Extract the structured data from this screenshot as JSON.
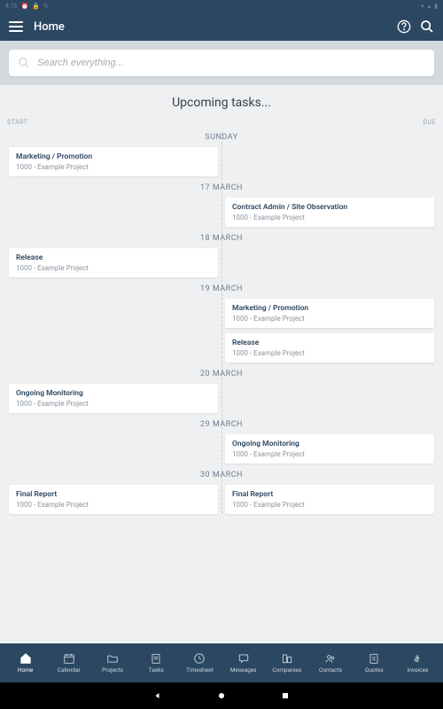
{
  "status": {
    "time": "4:16",
    "icons_left": [
      "clock",
      "lock",
      "sync"
    ],
    "icons_right": [
      "wifi",
      "signal",
      "battery"
    ]
  },
  "header": {
    "title": "Home"
  },
  "search": {
    "placeholder": "Search everything..."
  },
  "page_title": "Upcoming tasks...",
  "col_labels": {
    "start": "START",
    "due": "DUE"
  },
  "dates": [
    {
      "label": "SUNDAY",
      "left": [
        {
          "title": "Marketing / Promotion",
          "sub": "1000 - Example Project"
        }
      ],
      "right": []
    },
    {
      "label": "17 MARCH",
      "left": [],
      "right": [
        {
          "title": "Contract Admin / Site Observation",
          "sub": "1000 - Example Project"
        }
      ]
    },
    {
      "label": "18 MARCH",
      "left": [
        {
          "title": "Release",
          "sub": "1000 - Example Project"
        }
      ],
      "right": []
    },
    {
      "label": "19 MARCH",
      "left": [],
      "right": [
        {
          "title": "Marketing / Promotion",
          "sub": "1000 - Example Project"
        },
        {
          "title": "Release",
          "sub": "1000 - Example Project"
        }
      ]
    },
    {
      "label": "20 MARCH",
      "left": [
        {
          "title": "Ongoing Monitoring",
          "sub": "1000 - Example Project"
        }
      ],
      "right": []
    },
    {
      "label": "29 MARCH",
      "left": [],
      "right": [
        {
          "title": "Ongoing Monitoring",
          "sub": "1000 - Example Project"
        }
      ]
    },
    {
      "label": "30 MARCH",
      "left": [
        {
          "title": "Final Report",
          "sub": "1000 - Example Project"
        }
      ],
      "right": [
        {
          "title": "Final Report",
          "sub": "1000 - Example Project"
        }
      ]
    }
  ],
  "nav": [
    {
      "key": "home",
      "label": "Home",
      "active": true
    },
    {
      "key": "calendar",
      "label": "Calendar"
    },
    {
      "key": "projects",
      "label": "Projects"
    },
    {
      "key": "tasks",
      "label": "Tasks"
    },
    {
      "key": "timesheet",
      "label": "Timesheet"
    },
    {
      "key": "messages",
      "label": "Messages"
    },
    {
      "key": "companies",
      "label": "Companies"
    },
    {
      "key": "contacts",
      "label": "Contacts"
    },
    {
      "key": "quotes",
      "label": "Quotes"
    },
    {
      "key": "invoices",
      "label": "Invoices"
    }
  ],
  "colors": {
    "primary": "#2b4762"
  }
}
